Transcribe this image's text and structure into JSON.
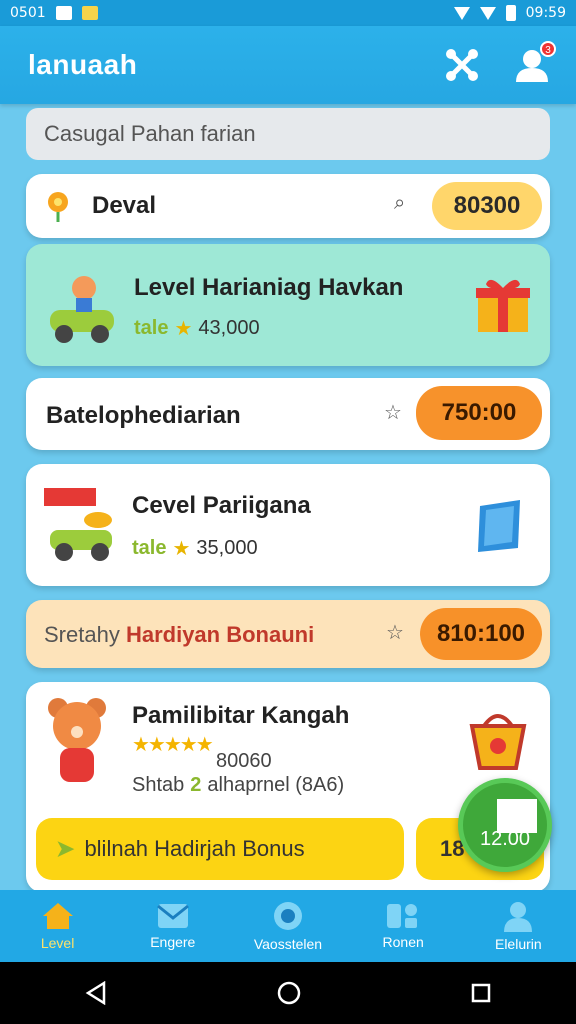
{
  "statusbar": {
    "left_text": "0501",
    "time": "09:59"
  },
  "appbar": {
    "title": "lanuaah",
    "notification_count": "3"
  },
  "search": {
    "placeholder": "Casugal Pahan farian"
  },
  "rows": [
    {
      "title": "Deval",
      "value": "80300"
    },
    {
      "title": "Level Harianiag Havkan",
      "tag": "tale",
      "amount": "43,000"
    },
    {
      "title": "Batelophediarian",
      "value": "750:00"
    },
    {
      "title": "Cevel Pariigana",
      "tag": "tale",
      "amount": "35,000"
    },
    {
      "title_prefix": "Sretahy",
      "title_highlight": "Hardiyan Bonauni",
      "value": "810:100"
    },
    {
      "title": "Pamilibitar Kangah",
      "price": "80060",
      "sub_prefix": "Shtab",
      "sub_num": "2",
      "sub_rest": "alhaprnel (8A6)"
    }
  ],
  "bonus": {
    "label": "blilnah Hadirjah Bonus",
    "partial": "18"
  },
  "fab": {
    "label": "12.00"
  },
  "nav": [
    {
      "label": "Level",
      "icon": "home-icon"
    },
    {
      "label": "Engere",
      "icon": "mail-icon"
    },
    {
      "label": "Vaosstelen",
      "icon": "coin-icon"
    },
    {
      "label": "Ronen",
      "icon": "grid-icon"
    },
    {
      "label": "Elelurin",
      "icon": "profile-icon"
    }
  ],
  "colors": {
    "primary": "#26a7e2",
    "accent_yellow": "#ffd66b",
    "accent_orange": "#f7922b",
    "highlight_red": "#c0392b"
  }
}
